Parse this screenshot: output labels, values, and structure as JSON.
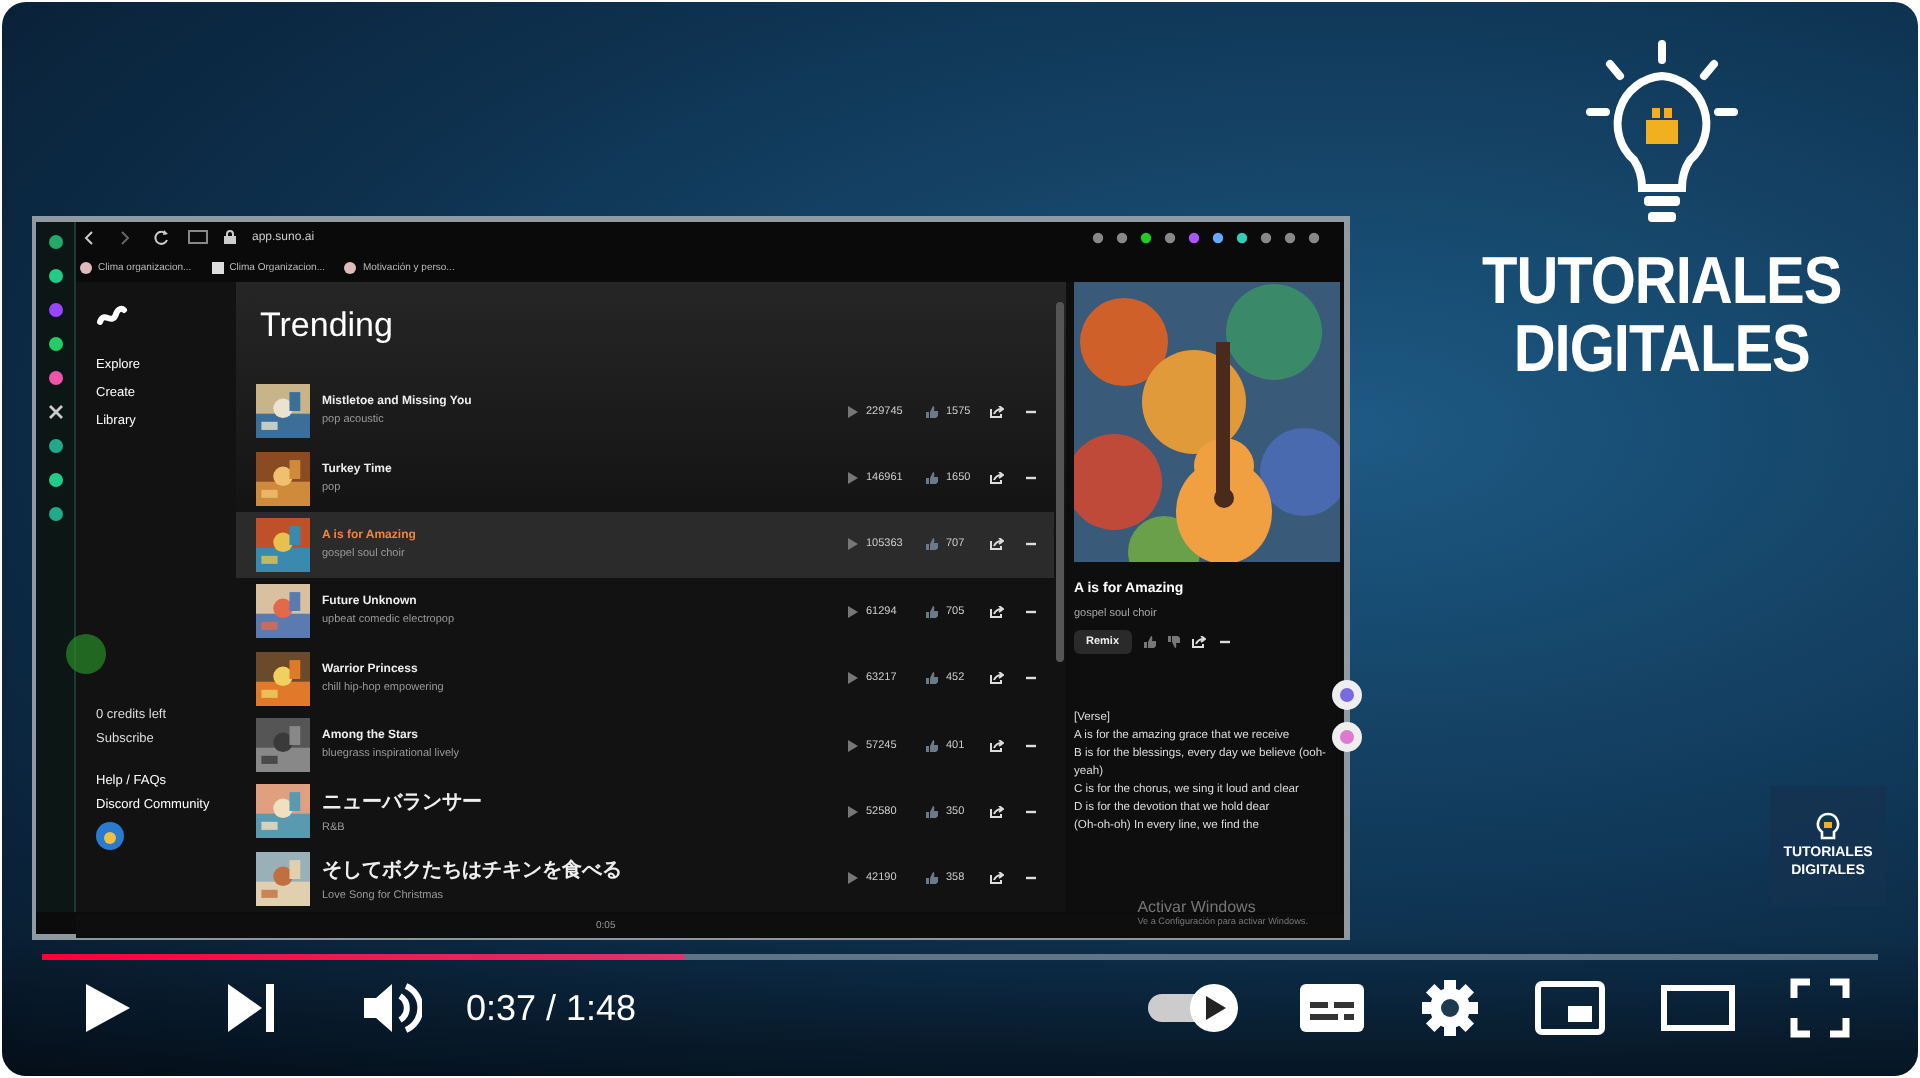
{
  "browser": {
    "url": "app.suno.ai",
    "bookmarks": [
      "Clima organizacion...",
      "Clima Organizacion...",
      "Motivación y perso..."
    ]
  },
  "app": {
    "nav": [
      "Explore",
      "Create",
      "Library"
    ],
    "credits": "0 credits left",
    "subscribe": "Subscribe",
    "links": [
      "Help / FAQs",
      "Discord Community"
    ],
    "heading": "Trending",
    "songs": [
      {
        "title": "Mistletoe and Missing You",
        "style": "pop acoustic",
        "plays": "229745",
        "likes": "1575",
        "selected": false
      },
      {
        "title": "Turkey Time",
        "style": "pop",
        "plays": "146961",
        "likes": "1650",
        "selected": false
      },
      {
        "title": "A is for Amazing",
        "style": "gospel soul choir",
        "plays": "105363",
        "likes": "707",
        "selected": true
      },
      {
        "title": "Future Unknown",
        "style": "upbeat comedic electropop",
        "plays": "61294",
        "likes": "705",
        "selected": false
      },
      {
        "title": "Warrior Princess",
        "style": "chill hip-hop empowering",
        "plays": "63217",
        "likes": "452",
        "selected": false
      },
      {
        "title": "Among the Stars",
        "style": "bluegrass inspirational lively",
        "plays": "57245",
        "likes": "401",
        "selected": false
      },
      {
        "title": "ニューバランサー",
        "style": "R&B",
        "plays": "52580",
        "likes": "350",
        "selected": false
      },
      {
        "title": "そしてボクたちはチキンを食べる",
        "style": "Love Song for Christmas",
        "plays": "42190",
        "likes": "358",
        "selected": false
      }
    ],
    "detail": {
      "title": "A is for Amazing",
      "style": "gospel soul choir",
      "remix": "Remix",
      "lyrics": [
        "[Verse]",
        "A is for the amazing grace that we receive",
        "B is for the blessings, every day we believe (ooh-yeah)",
        "C is for the chorus, we sing it loud and clear",
        "D is for the devotion that we hold dear",
        "(Oh-oh-oh) In every line, we find the"
      ]
    },
    "player_bar": {
      "time": "0:05"
    }
  },
  "os_notice": {
    "title": "Activar Windows",
    "text": "Ve a Configuración para activar Windows."
  },
  "channel_logo": {
    "lines": [
      "TUTORIALES",
      "DIGITALES"
    ]
  },
  "watermark": {
    "lines": [
      "TUTORIALES",
      "DIGITALES"
    ]
  },
  "player": {
    "progress": {
      "level": 0.35
    },
    "time": "0:37 / 1:48",
    "autoplay": {
      "on": true
    }
  }
}
